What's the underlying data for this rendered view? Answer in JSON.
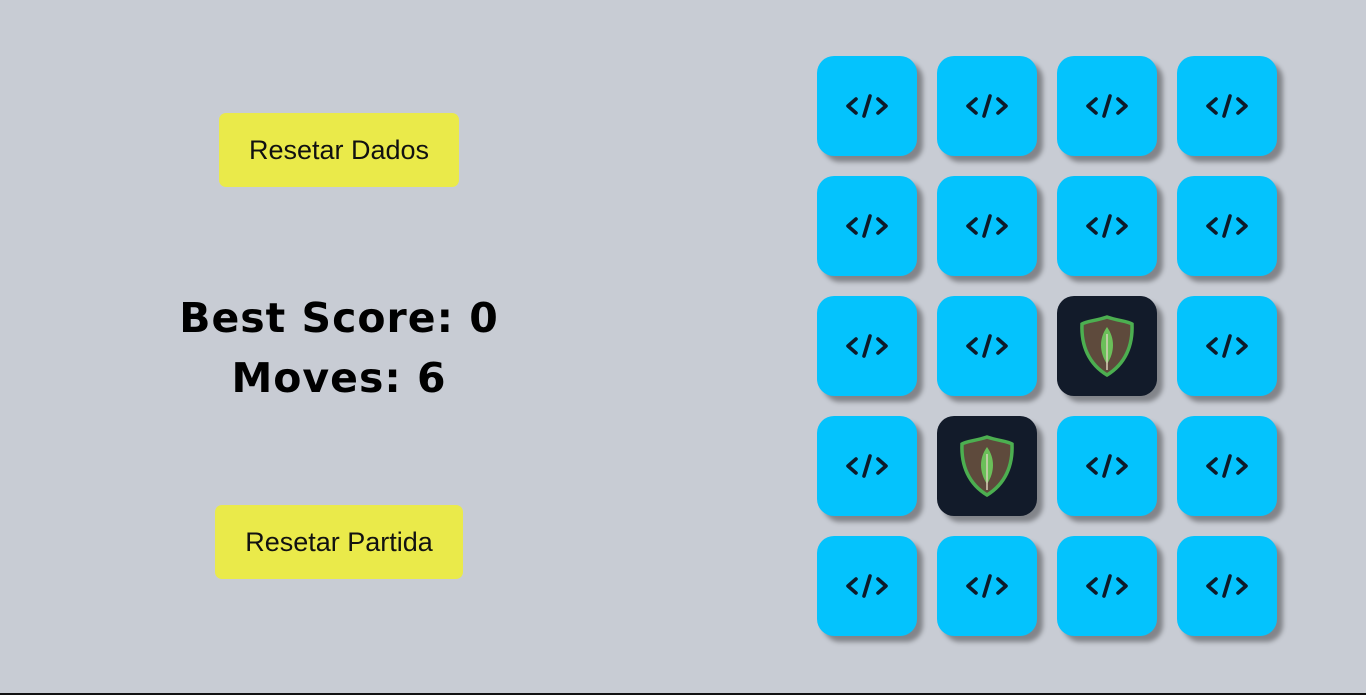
{
  "buttons": {
    "reset_data": "Resetar Dados",
    "reset_match": "Resetar Partida"
  },
  "stats": {
    "best_score": "Best Score: 0",
    "moves": "Moves: 6"
  },
  "board": {
    "rows": 5,
    "cols": 4,
    "card_back_icon": "code-icon",
    "colors": {
      "card_back": "#04c3fd",
      "card_front": "#121b2a",
      "button": "#eaea4a",
      "background": "#c8ccd4"
    },
    "cards": [
      {
        "state": "hidden",
        "icon": "code-icon"
      },
      {
        "state": "hidden",
        "icon": "code-icon"
      },
      {
        "state": "hidden",
        "icon": "code-icon"
      },
      {
        "state": "hidden",
        "icon": "code-icon"
      },
      {
        "state": "hidden",
        "icon": "code-icon"
      },
      {
        "state": "hidden",
        "icon": "code-icon"
      },
      {
        "state": "hidden",
        "icon": "code-icon"
      },
      {
        "state": "hidden",
        "icon": "code-icon"
      },
      {
        "state": "hidden",
        "icon": "code-icon"
      },
      {
        "state": "hidden",
        "icon": "code-icon"
      },
      {
        "state": "flipped",
        "icon": "mongodb-leaf-icon"
      },
      {
        "state": "hidden",
        "icon": "code-icon"
      },
      {
        "state": "hidden",
        "icon": "code-icon"
      },
      {
        "state": "flipped",
        "icon": "mongodb-leaf-icon"
      },
      {
        "state": "hidden",
        "icon": "code-icon"
      },
      {
        "state": "hidden",
        "icon": "code-icon"
      },
      {
        "state": "hidden",
        "icon": "code-icon"
      },
      {
        "state": "hidden",
        "icon": "code-icon"
      },
      {
        "state": "hidden",
        "icon": "code-icon"
      },
      {
        "state": "hidden",
        "icon": "code-icon"
      }
    ]
  }
}
